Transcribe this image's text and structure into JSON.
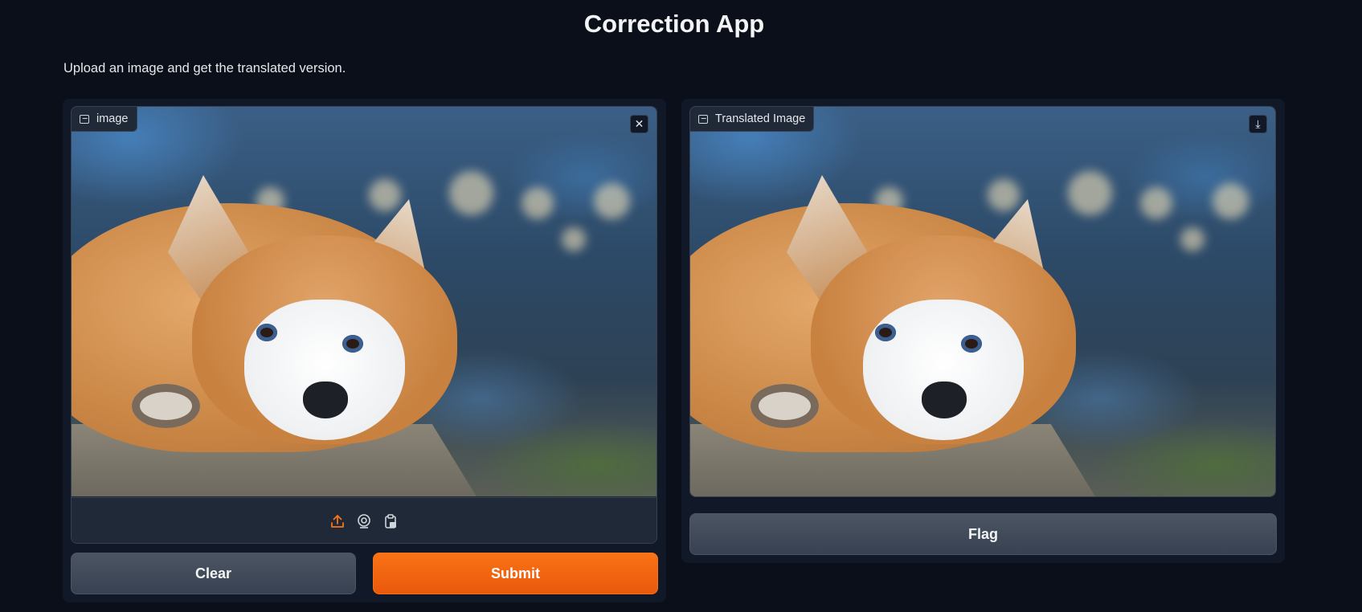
{
  "app": {
    "title": "Correction App",
    "description": "Upload an image and get the translated version."
  },
  "input_image": {
    "label": "image",
    "label_icon": "image-icon",
    "close_icon": "close-icon",
    "close_glyph": "✕",
    "sources": [
      "upload-icon",
      "webcam-icon",
      "clipboard-icon"
    ],
    "content": "corgi photo"
  },
  "output_image": {
    "label": "Translated Image",
    "label_icon": "image-icon",
    "download_icon": "download-icon",
    "download_glyph": "⤓",
    "content": "corgi photo"
  },
  "buttons": {
    "clear": "Clear",
    "submit": "Submit",
    "flag": "Flag"
  },
  "colors": {
    "background": "#0b0f19",
    "panel": "#111827",
    "primary": "#f97316",
    "secondary": "#4b5563",
    "active_source": "#f97316"
  }
}
